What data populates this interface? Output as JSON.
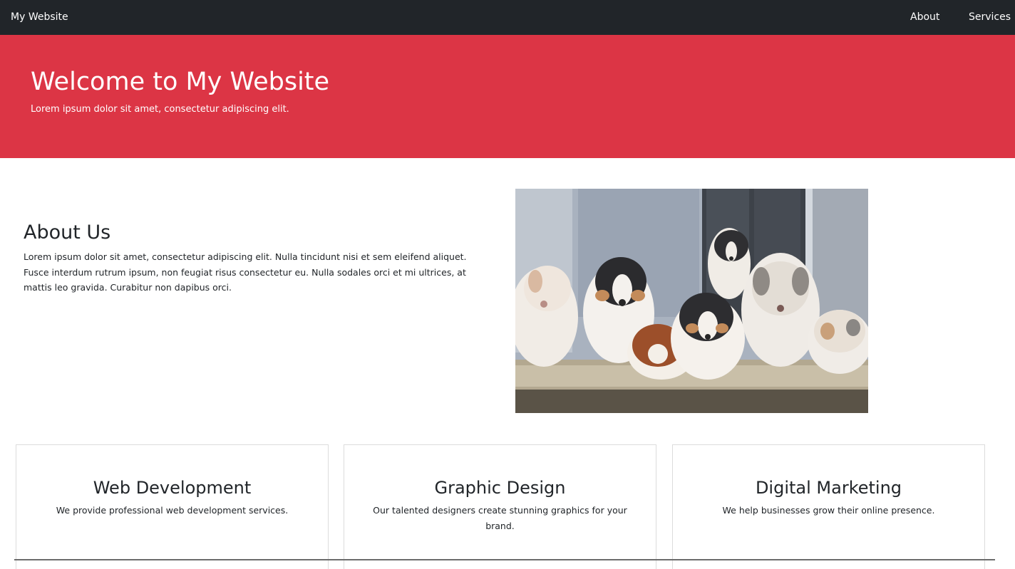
{
  "navbar": {
    "brand": "My Website",
    "links": [
      {
        "label": "About"
      },
      {
        "label": "Services"
      }
    ]
  },
  "hero": {
    "title": "Welcome to My Website",
    "subtitle": "Lorem ipsum dolor sit amet, consectetur adipiscing elit."
  },
  "about": {
    "title": "About Us",
    "text": "Lorem ipsum dolor sit amet, consectetur adipiscing elit. Nulla tincidunt nisi et sem eleifend aliquet. Fusce interdum rutrum ipsum, non feugiat risus consectetur eu. Nulla sodales orci et mi ultrices, at mattis leo gravida. Curabitur non dapibus orci.",
    "image_icon": "puppies-photo"
  },
  "services": [
    {
      "title": "Web Development",
      "text": "We provide professional web development services."
    },
    {
      "title": "Graphic Design",
      "text": "Our talented designers create stunning graphics for your brand."
    },
    {
      "title": "Digital Marketing",
      "text": "We help businesses grow their online presence."
    }
  ],
  "colors": {
    "navbar_bg": "#212529",
    "hero_bg": "#dc3545",
    "text": "#212529"
  }
}
